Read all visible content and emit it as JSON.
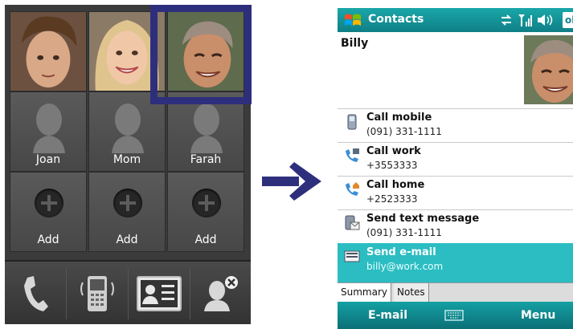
{
  "left_phone": {
    "row2_names": [
      "Joan",
      "Mom",
      "Farah"
    ],
    "row3_labels": [
      "Add",
      "Add",
      "Add"
    ],
    "bottom_icons": [
      "phone-icon",
      "phone-device-icon",
      "contact-card-icon",
      "remove-contact-icon"
    ],
    "selection_color": "#2e2f7c"
  },
  "right_phone": {
    "title": "Contacts",
    "ok_label": "ok",
    "contact_name": "Billy",
    "actions": [
      {
        "label": "Call mobile",
        "sub": "(091) 331-1111",
        "icon": "mobile-phone-icon"
      },
      {
        "label": "Call work",
        "sub": "+3553333",
        "icon": "work-phone-icon"
      },
      {
        "label": "Call home",
        "sub": "+2523333",
        "icon": "home-phone-icon"
      },
      {
        "label": "Send text message",
        "sub": "(091) 331-1111",
        "icon": "sms-icon"
      },
      {
        "label": "Send e-mail",
        "sub": "billy@work.com",
        "icon": "email-icon"
      }
    ],
    "tabs": [
      "Summary",
      "Notes"
    ],
    "softkey_left": "E-mail",
    "softkey_right": "Menu",
    "accent": "#12959a"
  }
}
